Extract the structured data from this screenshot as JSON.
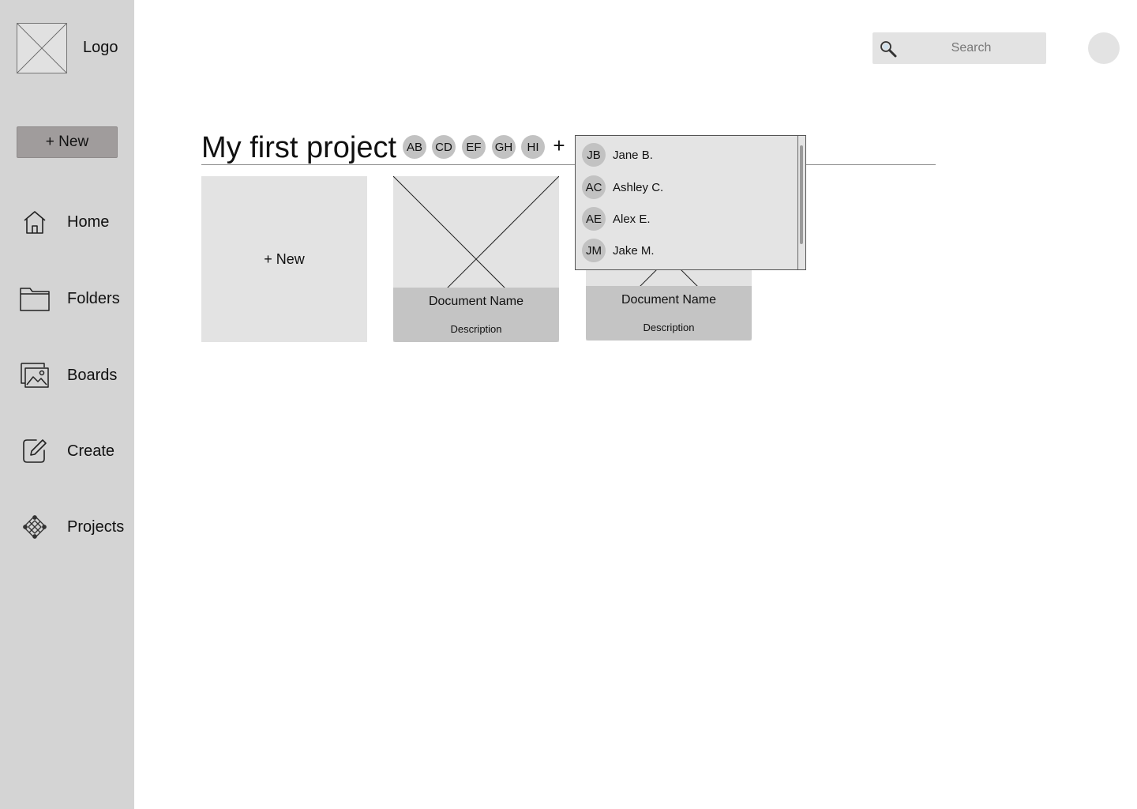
{
  "sidebar": {
    "logo_text": "Logo",
    "new_button": "+ New",
    "items": [
      {
        "label": "Home",
        "icon": "home-icon"
      },
      {
        "label": "Folders",
        "icon": "folder-icon"
      },
      {
        "label": "Boards",
        "icon": "images-icon"
      },
      {
        "label": "Create",
        "icon": "edit-icon"
      },
      {
        "label": "Projects",
        "icon": "projects-icon"
      }
    ]
  },
  "header": {
    "search_placeholder": "Search"
  },
  "project": {
    "title": "My first project",
    "members": [
      "AB",
      "CD",
      "EF",
      "GH",
      "HI"
    ],
    "add_member": "+"
  },
  "cards": {
    "new_label": "+ New",
    "documents": [
      {
        "name": "Document Name",
        "description": "Description"
      },
      {
        "name": "Document Name",
        "description": "Description"
      }
    ]
  },
  "member_dropdown": {
    "options": [
      {
        "initials": "JB",
        "name": "Jane B."
      },
      {
        "initials": "AC",
        "name": "Ashley C."
      },
      {
        "initials": "AE",
        "name": "Alex E."
      },
      {
        "initials": "JM",
        "name": "Jake M."
      }
    ]
  },
  "colors": {
    "sidebar_bg": "#d4d4d4",
    "new_button_bg": "#a09c9c",
    "card_bg": "#e3e3e3",
    "card_footer_bg": "#c4c4c4",
    "avatar_bg": "#c2c2c2"
  }
}
